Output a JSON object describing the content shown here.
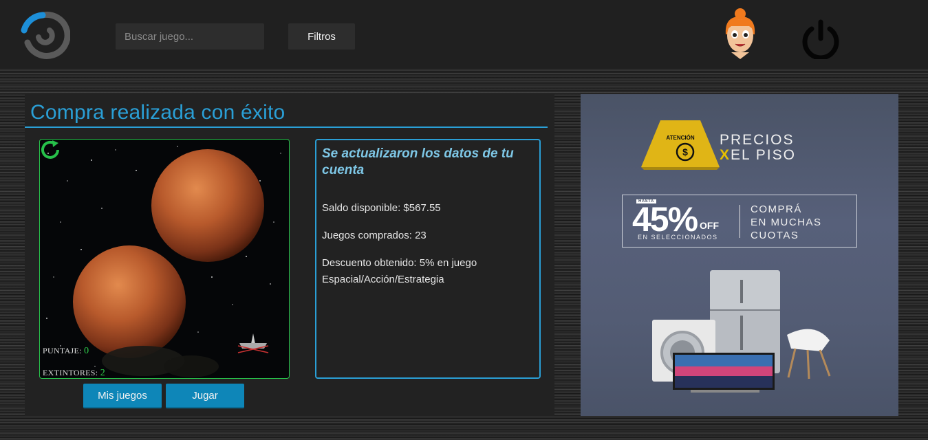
{
  "header": {
    "search_placeholder": "Buscar juego...",
    "filter_label": "Filtros"
  },
  "main": {
    "title": "Compra realizada con éxito",
    "game": {
      "score_label": "PUNTAJE:",
      "score_value": "0",
      "extinguishers_label": "EXTINTORES:",
      "extinguishers_value": "2"
    },
    "buttons": {
      "my_games": "Mis juegos",
      "play": "Jugar"
    },
    "info": {
      "heading": "Se actualizaron los datos de tu cuenta",
      "balance": "Saldo disponible: $567.55",
      "games_bought": "Juegos comprados: 23",
      "discount": "Descuento obtenido: 5% en juego Espacial/Acción/Estrategia"
    }
  },
  "ad": {
    "title_line1": "PRECIOS",
    "title_x": "X",
    "title_line2": "EL PISO",
    "sign_text": "ATENCIÓN",
    "hasta": "HASTA",
    "percent": "45%",
    "off": "OFF",
    "selected": "EN SELECCIONADOS",
    "cuotas_line1": "COMPRÁ",
    "cuotas_line2": "EN MUCHAS",
    "cuotas_line3": "CUOTAS"
  },
  "colors": {
    "accent_blue": "#2a9fd6",
    "game_border_green": "#27c04a",
    "button_blue": "#0e86b8"
  }
}
